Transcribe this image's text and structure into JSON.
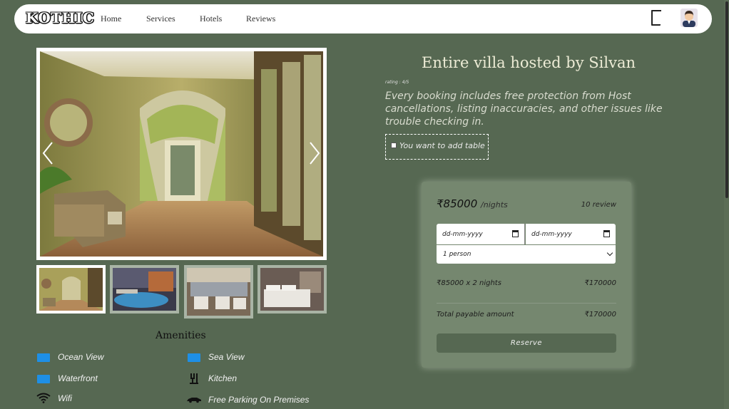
{
  "nav": {
    "logo": "KOTHIC",
    "links": [
      "Home",
      "Services",
      "Hotels",
      "Reviews"
    ]
  },
  "gallery": {
    "main_alt": "Villa hallway with armchair and arched curtains",
    "thumbnails": [
      "Hallway interior",
      "Pool at night",
      "Restaurant dining area",
      "Bedroom"
    ]
  },
  "amenities": {
    "title": "Amenities",
    "items": [
      {
        "label": "Ocean View",
        "icon": "ocean-view-icon"
      },
      {
        "label": "Sea View",
        "icon": "sea-view-icon"
      },
      {
        "label": "Waterfront",
        "icon": "waterfront-icon"
      },
      {
        "label": "Kitchen",
        "icon": "kitchen-icon"
      },
      {
        "label": "Wifi",
        "icon": "wifi-icon"
      },
      {
        "label": "Free Parking On Premises",
        "icon": "car-icon"
      }
    ]
  },
  "listing": {
    "title": "Entire villa hosted by Silvan",
    "rating": "rating : 4/5",
    "description": "Every booking includes free protection from Host cancellations, listing inaccuracies, and other issues like trouble checking in.",
    "add_table_label": "You want to add table"
  },
  "booking": {
    "price": "₹85000",
    "per": "/nights",
    "reviews": "10 review",
    "checkin_placeholder": "dd-mm-yyyy",
    "checkout_placeholder": "dd-mm-yyyy",
    "guests": "1 person",
    "calc_label": "₹85000 x 2 nights",
    "calc_value": "₹170000",
    "total_label": "Total payable amount",
    "total_value": "₹170000",
    "reserve_label": "Reserve"
  },
  "colors": {
    "page_bg": "#566852",
    "card_bg": "#75876f",
    "amenity_icon": "#1e8fe6"
  }
}
